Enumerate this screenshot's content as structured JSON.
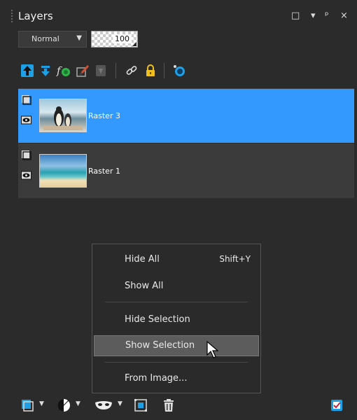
{
  "window": {
    "title": "Layers",
    "buttons": {
      "maximize": "□",
      "menu": "▾",
      "pin": "ᵖ",
      "close": "×"
    }
  },
  "properties": {
    "blend_mode": "Normal",
    "opacity": "100"
  },
  "toolbar": {
    "icons": [
      "move-up-icon",
      "move-down-icon",
      "fx-icon",
      "brush-icon",
      "ghost-icon",
      "link-icon",
      "lock-icon",
      "preview-icon"
    ]
  },
  "layers": [
    {
      "name": "Raster 3",
      "selected": true
    },
    {
      "name": "Raster 1",
      "selected": false
    }
  ],
  "context_menu": {
    "items": [
      {
        "label": "Hide All",
        "shortcut": "Shift+Y"
      },
      {
        "label": "Show All",
        "shortcut": ""
      },
      {
        "label": "Hide Selection",
        "shortcut": ""
      },
      {
        "label": "Show Selection",
        "shortcut": ""
      },
      {
        "label": "From Image...",
        "shortcut": ""
      }
    ],
    "highlighted": "Show Selection"
  },
  "bottom_bar": {
    "icons": [
      "new-layer-icon",
      "adjustment-icon",
      "mask-icon",
      "group-icon",
      "delete-icon",
      "properties-icon"
    ]
  },
  "colors": {
    "selected": "#3399ff",
    "panel": "#2b2b2b",
    "row": "#3b3b3b",
    "accent_blue": "#1ea0e6",
    "lock_yellow": "#f0c020"
  }
}
